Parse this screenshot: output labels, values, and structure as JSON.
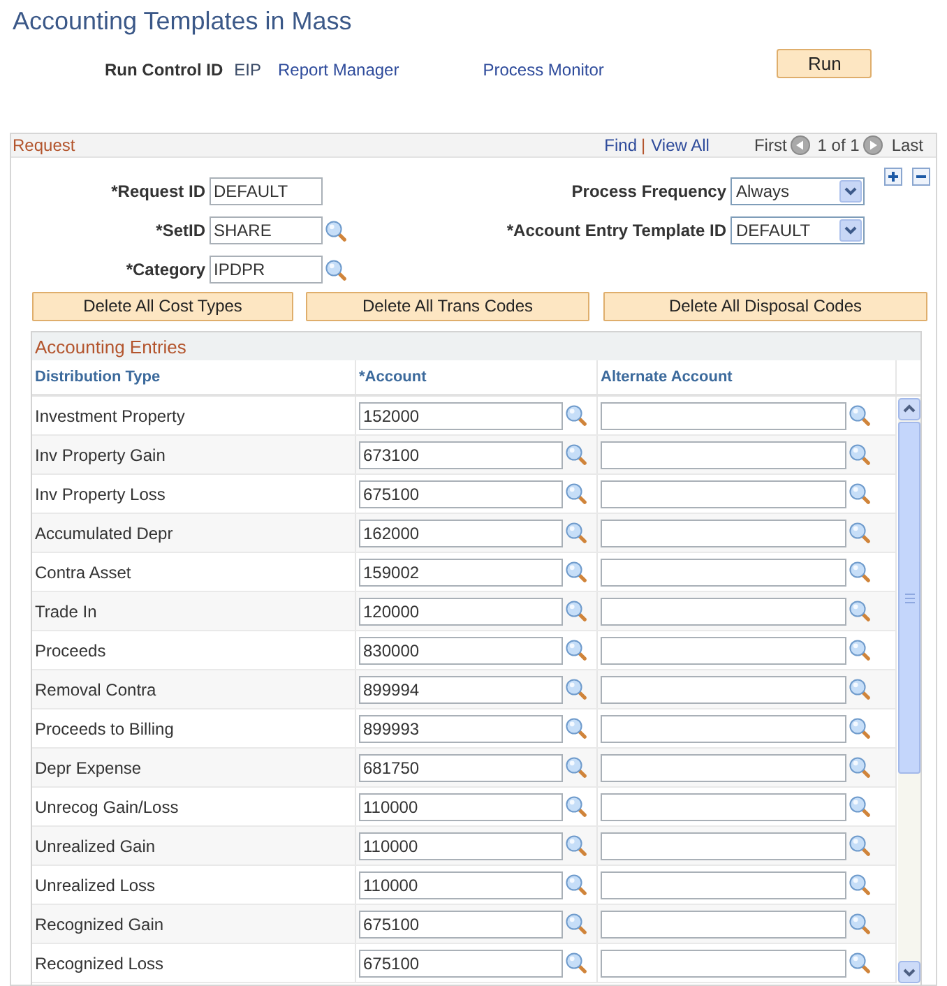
{
  "page_title": "Accounting Templates in Mass",
  "run_control": {
    "label": "Run Control ID",
    "value": "EIP",
    "links": [
      "Report Manager",
      "Process Monitor"
    ],
    "run_button": "Run"
  },
  "request": {
    "title": "Request",
    "find": "Find",
    "separator": "|",
    "view_all": "View All",
    "first": "First",
    "count": "1 of 1",
    "last": "Last",
    "left_fields": [
      {
        "kind": "text",
        "label": "*Request ID",
        "value": "DEFAULT"
      },
      {
        "kind": "lookup",
        "label": "*SetID",
        "value": "SHARE"
      },
      {
        "kind": "lookup",
        "label": "*Category",
        "value": "IPDPR"
      }
    ],
    "right_fields": [
      {
        "kind": "select",
        "label": "Process Frequency",
        "value": "Always"
      },
      {
        "kind": "select",
        "label": "*Account Entry Template ID",
        "value": "DEFAULT"
      }
    ],
    "buttons": [
      "Delete All Cost Types",
      "Delete All Trans Codes",
      "Delete All Disposal Codes"
    ],
    "accounting_entries": {
      "title": "Accounting Entries",
      "columns": [
        "Distribution Type",
        "*Account",
        "Alternate Account"
      ],
      "rows": [
        {
          "distribution_type": "Investment Property",
          "account": "152000"
        },
        {
          "distribution_type": "Inv Property Gain",
          "account": "673100"
        },
        {
          "distribution_type": "Inv Property Loss",
          "account": "675100"
        },
        {
          "distribution_type": "Accumulated Depr",
          "account": "162000"
        },
        {
          "distribution_type": "Contra Asset",
          "account": "159002"
        },
        {
          "distribution_type": "Trade In",
          "account": "120000"
        },
        {
          "distribution_type": "Proceeds",
          "account": "830000"
        },
        {
          "distribution_type": "Removal Contra",
          "account": "899994"
        },
        {
          "distribution_type": "Proceeds to Billing",
          "account": "899993"
        },
        {
          "distribution_type": "Depr Expense",
          "account": "681750"
        },
        {
          "distribution_type": "Unrecog Gain/Loss",
          "account": "110000"
        },
        {
          "distribution_type": "Unrealized Gain",
          "account": "110000"
        },
        {
          "distribution_type": "Unrealized Loss",
          "account": "110000"
        },
        {
          "distribution_type": "Recognized Gain",
          "account": "675100"
        },
        {
          "distribution_type": "Recognized Loss",
          "account": "675100"
        }
      ]
    }
  }
}
